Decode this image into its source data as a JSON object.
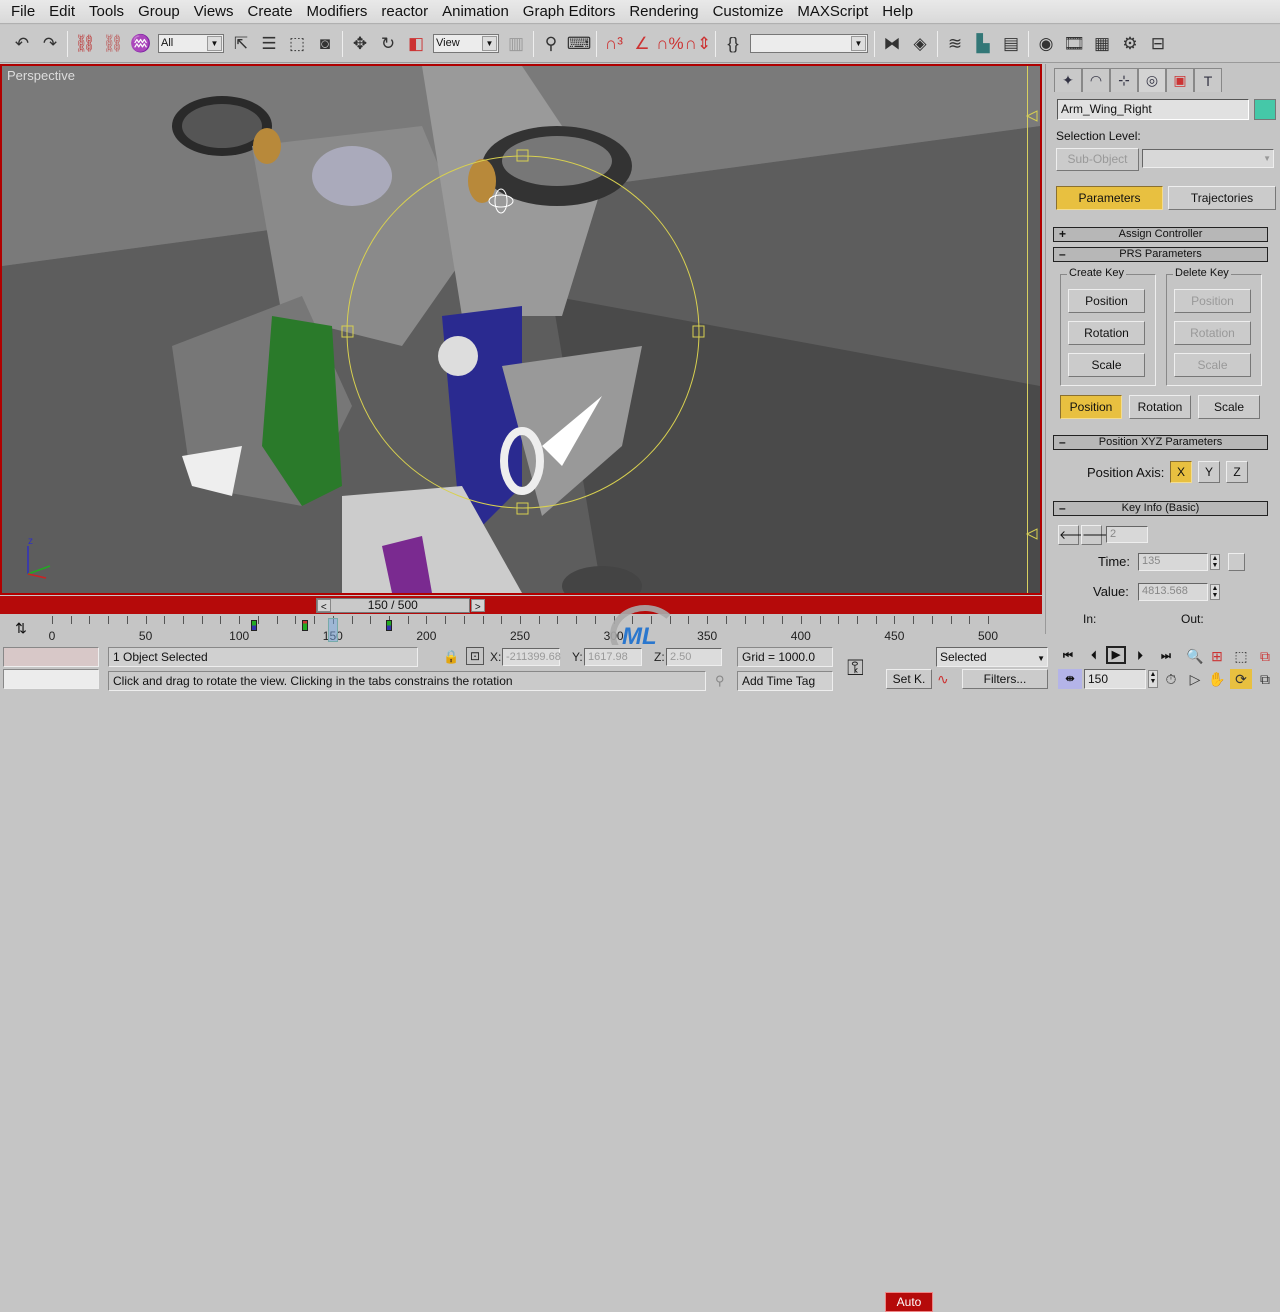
{
  "menu": [
    "File",
    "Edit",
    "Tools",
    "Group",
    "Views",
    "Create",
    "Modifiers",
    "reactor",
    "Animation",
    "Graph Editors",
    "Rendering",
    "Customize",
    "MAXScript",
    "Help"
  ],
  "toolbar": {
    "selection_filter": "All",
    "reference_coord": "View",
    "named_selection": "",
    "icons": [
      "undo-icon",
      "redo-icon",
      "select-and-link-icon",
      "unlink-icon",
      "bind-space-warp-icon",
      "select-object-icon",
      "select-by-name-icon",
      "rect-selection-icon",
      "window-crossing-icon",
      "move-icon",
      "rotate-icon",
      "scale-icon",
      "use-pivot-icon",
      "select-manipulate-icon",
      "keyboard-shortcut-icon",
      "snaps-toggle-icon",
      "angle-snap-icon",
      "percent-snap-icon",
      "spinner-snap-icon",
      "edit-named-selection-icon",
      "mirror-icon",
      "align-icon",
      "layer-manager-icon",
      "schematic-view-icon",
      "material-editor-icon",
      "render-setup-icon",
      "render-frame-icon",
      "render-table-icon",
      "quick-render-icon",
      "active-shade-icon"
    ]
  },
  "viewport": {
    "label": "Perspective",
    "axis_label": "z"
  },
  "command_panel": {
    "tabs": [
      "create-tab",
      "modify-tab",
      "hierarchy-tab",
      "motion-tab",
      "display-tab",
      "utilities-tab"
    ],
    "object_name": "Arm_Wing_Right",
    "object_color": "#45c8a8",
    "selection_level_label": "Selection Level:",
    "sub_object_label": "Sub-Object",
    "sub_object_value": "",
    "parameters_label": "Parameters",
    "trajectories_label": "Trajectories",
    "assign_controller": "Assign Controller",
    "prs_parameters": "PRS Parameters",
    "create_key": {
      "title": "Create Key",
      "buttons": [
        "Position",
        "Rotation",
        "Scale"
      ]
    },
    "delete_key": {
      "title": "Delete Key",
      "buttons": [
        "Position",
        "Rotation",
        "Scale"
      ]
    },
    "prs_tabs": [
      "Position",
      "Rotation",
      "Scale"
    ],
    "position_xyz": "Position XYZ Parameters",
    "position_axis_label": "Position Axis:",
    "axes": [
      "X",
      "Y",
      "Z"
    ],
    "key_info": "Key Info (Basic)",
    "key_number": "2",
    "time_label": "Time:",
    "time_value": "135",
    "value_label": "Value:",
    "value_value": "4813.568",
    "in_label": "In:",
    "out_label": "Out:"
  },
  "timeline": {
    "slider_text": "150 / 500",
    "current_frame": 150,
    "total_frames": 500,
    "tick_labels": [
      "0",
      "50",
      "100",
      "150",
      "200",
      "250",
      "300",
      "350",
      "400",
      "450",
      "500"
    ],
    "key_frames": [
      108,
      135,
      180
    ]
  },
  "status": {
    "selection": "1 Object Selected",
    "prompt": "Click and drag to rotate the view.  Clicking in the tabs constrains the rotation",
    "x_label": "X:",
    "x_value": "-211399.68",
    "y_label": "Y:",
    "y_value": "1617.98",
    "z_label": "Z:",
    "z_value": "2.50",
    "grid": "Grid = 1000.0",
    "add_time_tag": "Add Time Tag",
    "auto_key": "Auto",
    "set_key": "Set K.",
    "key_filter": "Selected",
    "filters": "Filters...",
    "frame_field": "150"
  }
}
